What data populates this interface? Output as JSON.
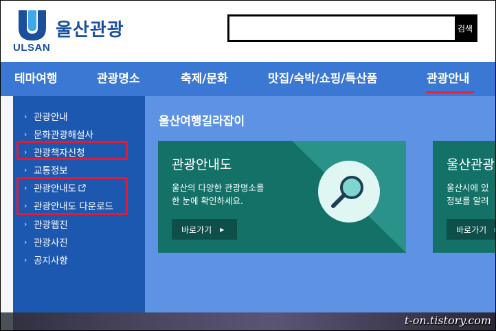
{
  "header": {
    "brand_name": "울산관광",
    "brand_sub": "ULSAN",
    "search_placeholder": "",
    "search_button": "검색"
  },
  "nav": {
    "items": [
      "테마여행",
      "관광명소",
      "축제/문화",
      "맛집/숙박/쇼핑/특산품",
      "관광안내"
    ],
    "active_index": 4
  },
  "sidebar": {
    "items": [
      {
        "label": "관광안내",
        "external": false
      },
      {
        "label": "문화관광해설사",
        "external": false
      },
      {
        "label": "관광책자신청",
        "external": false
      },
      {
        "label": "교통정보",
        "external": false
      },
      {
        "label": "관광안내도",
        "external": true
      },
      {
        "label": "관광안내도 다운로드",
        "external": false
      },
      {
        "label": "관광웹진",
        "external": false
      },
      {
        "label": "관광사진",
        "external": false
      },
      {
        "label": "공지사항",
        "external": false
      }
    ]
  },
  "main": {
    "section_title": "울산여행길라잡이",
    "cards": [
      {
        "title": "관광안내도",
        "desc_line1": "울산의 다양한 관광명소를",
        "desc_line2": "한 눈에 확인하세요.",
        "button": "바로가기"
      },
      {
        "title": "울산관광",
        "desc_line1": "울산시에 있",
        "desc_line2": "정보를 알려",
        "button": "바로가기"
      }
    ]
  },
  "watermark": "t-on.tistory.com",
  "colors": {
    "brand": "#1a4f9c",
    "nav_bg": "#3a78d3",
    "sidebar_bg": "#1d58b0",
    "main_bg": "#5e93e4",
    "card_bg": "#137168",
    "highlight": "#e21a35",
    "active_underline": "#e8223c"
  }
}
